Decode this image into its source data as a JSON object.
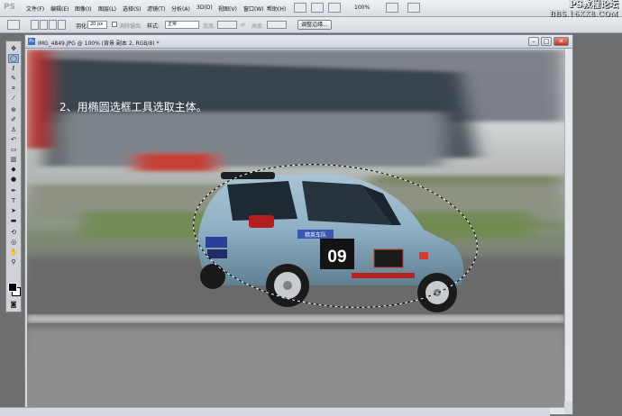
{
  "app": {
    "logo": "PS",
    "menu": [
      "文件(F)",
      "编辑(E)",
      "图像(I)",
      "图层(L)",
      "选择(S)",
      "滤镜(T)",
      "分析(A)",
      "3D(D)",
      "视图(V)",
      "窗口(W)",
      "帮助(H)"
    ],
    "zoom": "100%"
  },
  "brand": {
    "line1": "PS教程论坛",
    "line2": "BBS.16XX8.COM"
  },
  "options": {
    "feather_label": "羽化:",
    "feather_value": "20 px",
    "antialias_label": "消除锯齿",
    "style_label": "样式:",
    "style_value": "正常",
    "width_label": "宽度:",
    "height_label": "高度:",
    "refine_edge_button": "调整边缘..."
  },
  "document": {
    "title": "IMG_4849.JPG @ 100% (背景 副本 2, RGB/8) *",
    "tab_icon": "Ps"
  },
  "canvas": {
    "caption": "2、用椭圆选框工具选取主体。",
    "car_number": "09",
    "car_side_text": "精英车队"
  },
  "colors": {
    "foreground": "#000000",
    "background": "#ffffff",
    "car_body": "#8fb0c4"
  }
}
